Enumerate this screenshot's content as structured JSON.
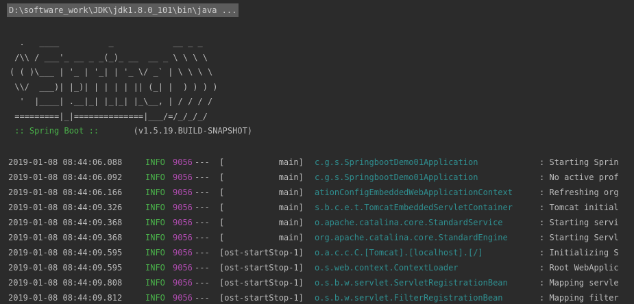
{
  "console": {
    "command": "D:\\software_work\\JDK\\jdk1.8.0_101\\bin\\java ...",
    "banner_lines": [
      "  .   ____          _            __ _ _",
      " /\\\\ / ___'_ __ _ _(_)_ __  __ _ \\ \\ \\ \\",
      "( ( )\\___ | '_ | '_| | '_ \\/ _` | \\ \\ \\ \\",
      " \\\\/  ___)| |_)| | | | | || (_| |  ) ) ) )",
      "  '  |____| .__|_| |_|_| |_\\__, | / / / /",
      " =========|_|==============|___/=/_/_/_/"
    ],
    "boot_label": " :: Spring Boot :: ",
    "boot_version": "      (v1.5.19.BUILD-SNAPSHOT)",
    "colors": {
      "background": "#2b2b2b",
      "default_text": "#bbbbbb",
      "info_level": "#4ab14a",
      "pid": "#b04cb0",
      "logger": "#2f8f90",
      "command_highlight": "#5c5c5c"
    },
    "log_rows": [
      {
        "timestamp": "2019-01-08 08:44:06.088",
        "level": "INFO",
        "pid": "9056",
        "sep": "---",
        "thread": "[           main]",
        "logger": "c.g.s.SpringbootDemo01Application",
        "message": ": Starting Sprin"
      },
      {
        "timestamp": "2019-01-08 08:44:06.092",
        "level": "INFO",
        "pid": "9056",
        "sep": "---",
        "thread": "[           main]",
        "logger": "c.g.s.SpringbootDemo01Application",
        "message": ": No active prof"
      },
      {
        "timestamp": "2019-01-08 08:44:06.166",
        "level": "INFO",
        "pid": "9056",
        "sep": "---",
        "thread": "[           main]",
        "logger": "ationConfigEmbeddedWebApplicationContext",
        "message": ": Refreshing org"
      },
      {
        "timestamp": "2019-01-08 08:44:09.326",
        "level": "INFO",
        "pid": "9056",
        "sep": "---",
        "thread": "[           main]",
        "logger": "s.b.c.e.t.TomcatEmbeddedServletContainer",
        "message": ": Tomcat initial"
      },
      {
        "timestamp": "2019-01-08 08:44:09.368",
        "level": "INFO",
        "pid": "9056",
        "sep": "---",
        "thread": "[           main]",
        "logger": "o.apache.catalina.core.StandardService",
        "message": ": Starting servi"
      },
      {
        "timestamp": "2019-01-08 08:44:09.368",
        "level": "INFO",
        "pid": "9056",
        "sep": "---",
        "thread": "[           main]",
        "logger": "org.apache.catalina.core.StandardEngine",
        "message": ": Starting Servl"
      },
      {
        "timestamp": "2019-01-08 08:44:09.595",
        "level": "INFO",
        "pid": "9056",
        "sep": "---",
        "thread": "[ost-startStop-1]",
        "logger": "o.a.c.c.C.[Tomcat].[localhost].[/]",
        "message": ": Initializing S"
      },
      {
        "timestamp": "2019-01-08 08:44:09.595",
        "level": "INFO",
        "pid": "9056",
        "sep": "---",
        "thread": "[ost-startStop-1]",
        "logger": "o.s.web.context.ContextLoader",
        "message": ": Root WebApplic"
      },
      {
        "timestamp": "2019-01-08 08:44:09.808",
        "level": "INFO",
        "pid": "9056",
        "sep": "---",
        "thread": "[ost-startStop-1]",
        "logger": "o.s.b.w.servlet.ServletRegistrationBean",
        "message": ": Mapping servle"
      },
      {
        "timestamp": "2019-01-08 08:44:09.812",
        "level": "INFO",
        "pid": "9056",
        "sep": "---",
        "thread": "[ost-startStop-1]",
        "logger": "o.s.b.w.servlet.FilterRegistrationBean",
        "message": ": Mapping filter"
      }
    ]
  }
}
